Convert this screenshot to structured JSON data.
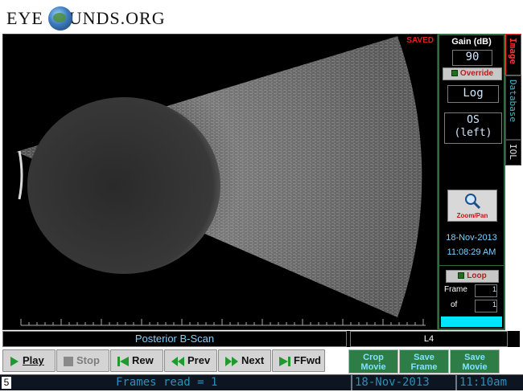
{
  "site": {
    "logo_text_left": "EYE",
    "logo_text_right": "UNDS.ORG"
  },
  "scan": {
    "saved_label": "SAVED"
  },
  "side_panel": {
    "gain_title": "Gain (dB)",
    "gain_value": "90",
    "override_label": "Override",
    "scale_value": "Log",
    "eye_line1": "OS",
    "eye_line2": "(left)",
    "zoom_label": "Zoom/Pan",
    "date": "18-Nov-2013",
    "time": "11:08:29 AM",
    "loop_label": "Loop",
    "frame_label": "Frame",
    "of_label": "of",
    "frame_value": "1",
    "of_value": "1"
  },
  "tabs": [
    {
      "label": "Image",
      "color": "#ff3030"
    },
    {
      "label": "Database",
      "color": "#3fb8c8"
    },
    {
      "label": "IOL",
      "color": "#e0e0e0"
    }
  ],
  "info": {
    "view_label": "Posterior B-Scan",
    "probe_label": "L4"
  },
  "controls": {
    "play": "Play",
    "stop": "Stop",
    "rew": "Rew",
    "prev": "Prev",
    "next": "Next",
    "ffwd": "FFwd",
    "crop_line1": "Crop",
    "crop_line2": "Movie",
    "saveframe_line1": "Save",
    "saveframe_line2": "Frame",
    "savemovie_line1": "Save",
    "savemovie_line2": "Movie"
  },
  "status": {
    "number": "5",
    "frames_read": "Frames read = 1",
    "date": "18-Nov-2013",
    "time": "11:10am"
  },
  "colors": {
    "accent_green": "#2e7d46",
    "cyan": "#00e5ff",
    "alert_red": "#e02020"
  }
}
